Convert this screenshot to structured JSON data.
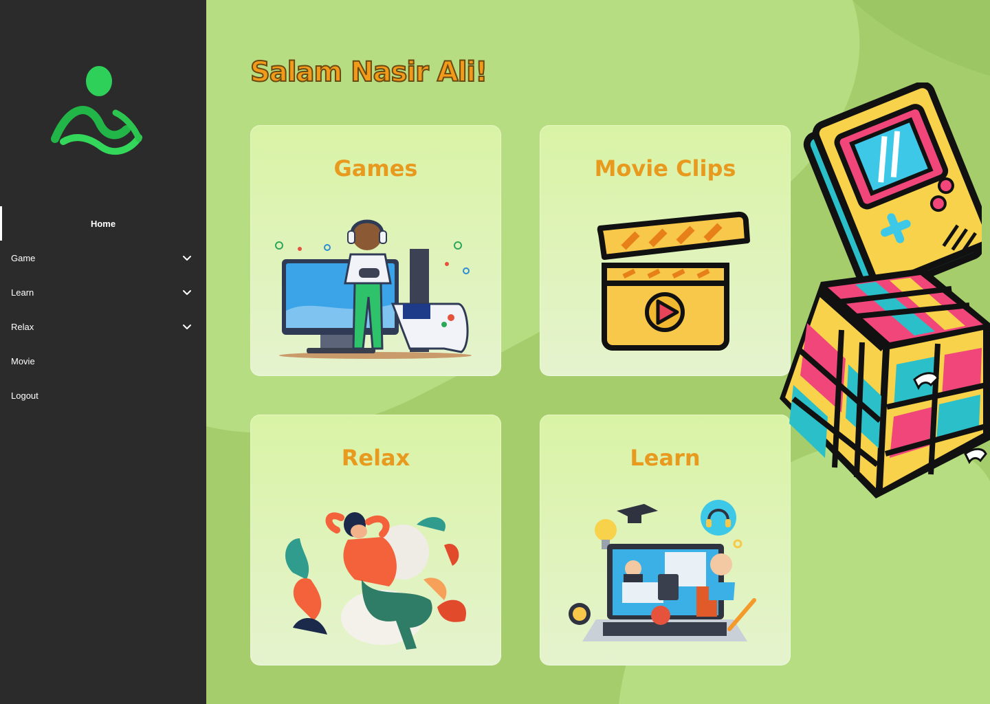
{
  "greeting": "Salam Nasir Ali!",
  "sidebar": {
    "logo": "app-logo",
    "items": [
      {
        "label": "Home",
        "active": true
      },
      {
        "label": "Game",
        "has_submenu": true
      },
      {
        "label": "Learn",
        "has_submenu": true
      },
      {
        "label": "Relax",
        "has_submenu": true
      },
      {
        "label": "Movie"
      },
      {
        "label": "Logout"
      }
    ]
  },
  "cards": [
    {
      "title": "Games",
      "icon": "gamer-illustration"
    },
    {
      "title": "Movie Clips",
      "icon": "clapperboard-icon"
    },
    {
      "title": "Relax",
      "icon": "relaxing-woman-illustration"
    },
    {
      "title": "Learn",
      "icon": "online-learning-illustration"
    }
  ],
  "decorations": [
    "gameboy-illustration",
    "rubiks-cube-illustration"
  ],
  "colors": {
    "sidebar": "#2b2b2b",
    "background": "#a6cd6c",
    "accent": "#f29a1a",
    "card": "#dff3b8",
    "logo_green": "#2fd05a"
  }
}
